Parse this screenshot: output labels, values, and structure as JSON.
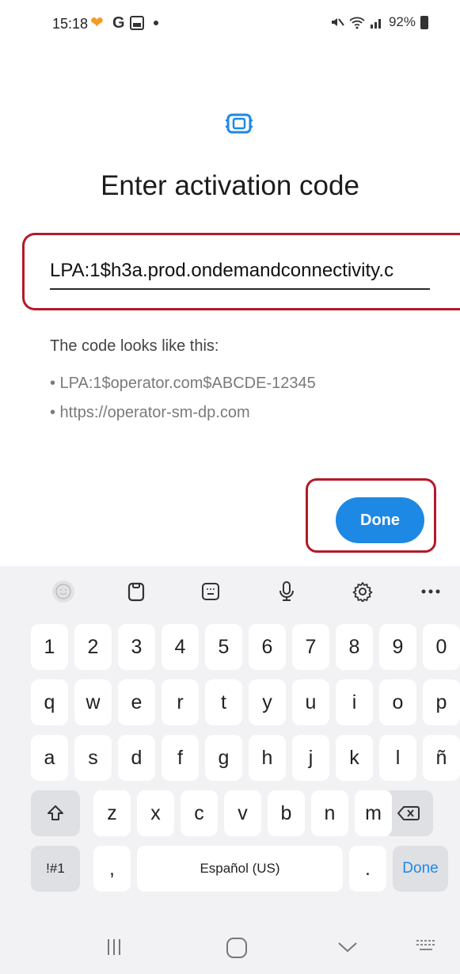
{
  "status_bar": {
    "time": "15:18",
    "right_text": "92%"
  },
  "header": {
    "title": "Enter activation code"
  },
  "input": {
    "value": "LPA:1$h3a.prod.ondemandconnectivity.c"
  },
  "hints": {
    "title": "The code looks like this:",
    "line1": "• LPA:1$operator.com$ABCDE-12345",
    "line2": "• https://operator-sm-dp.com"
  },
  "actions": {
    "done_label": "Done"
  },
  "keyboard": {
    "number_row": [
      "1",
      "2",
      "3",
      "4",
      "5",
      "6",
      "7",
      "8",
      "9",
      "0"
    ],
    "row1": [
      "q",
      "w",
      "e",
      "r",
      "t",
      "y",
      "u",
      "i",
      "o",
      "p"
    ],
    "row2": [
      "a",
      "s",
      "d",
      "f",
      "g",
      "h",
      "j",
      "k",
      "l",
      "ñ"
    ],
    "row3": [
      "z",
      "x",
      "c",
      "v",
      "b",
      "n",
      "m"
    ],
    "symbols_label": "!#1",
    "comma_label": ",",
    "space_label": "Español (US)",
    "period_label": ".",
    "done_label": "Done"
  },
  "colors": {
    "accent": "#1e88e5",
    "highlight_frame": "#b5192a"
  }
}
